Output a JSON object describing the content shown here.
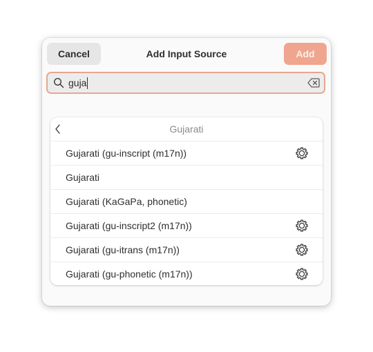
{
  "dialog": {
    "title": "Add Input Source",
    "cancel_label": "Cancel",
    "add_label": "Add"
  },
  "search": {
    "value": "guja"
  },
  "list": {
    "title": "Gujarati",
    "items": [
      {
        "label": "Gujarati (gu-inscript (m17n))",
        "has_settings": true
      },
      {
        "label": "Gujarati",
        "has_settings": false
      },
      {
        "label": "Gujarati (KaGaPa, phonetic)",
        "has_settings": false
      },
      {
        "label": "Gujarati (gu-inscript2 (m17n))",
        "has_settings": true
      },
      {
        "label": "Gujarati (gu-itrans (m17n))",
        "has_settings": true
      },
      {
        "label": "Gujarati (gu-phonetic (m17n))",
        "has_settings": true
      }
    ]
  },
  "colors": {
    "accent": "#f0a58e",
    "focus_border": "#e8a68f"
  },
  "icons": {
    "search": "search-icon",
    "clear": "clear-icon",
    "back": "back-icon",
    "settings": "gear-icon"
  }
}
